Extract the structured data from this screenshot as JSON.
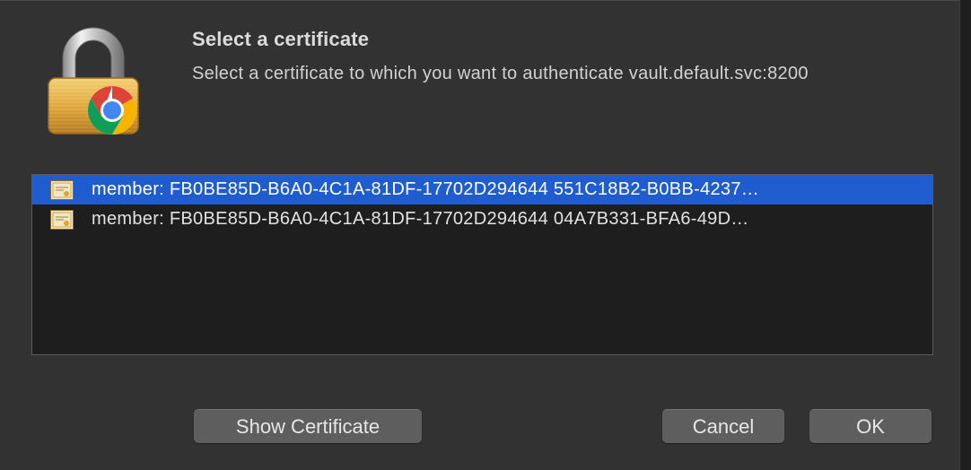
{
  "dialog": {
    "title": "Select a certificate",
    "message": "Select a certificate to which you want to authenticate vault.default.svc:8200",
    "app_icon": "lock-with-chrome-badge-icon"
  },
  "certificates": [
    {
      "label": "member: FB0BE85D-B6A0-4C1A-81DF-17702D294644 551C18B2-B0BB-4237…",
      "selected": true,
      "icon": "certificate-icon"
    },
    {
      "label": "member: FB0BE85D-B6A0-4C1A-81DF-17702D294644 04A7B331-BFA6-49D…",
      "selected": false,
      "icon": "certificate-icon"
    }
  ],
  "buttons": {
    "show_certificate": "Show Certificate",
    "cancel": "Cancel",
    "ok": "OK"
  },
  "colors": {
    "dialog_bg": "#323232",
    "list_bg": "#1e1e1e",
    "selection": "#1f5ccf",
    "button_bg": "#5e5e5e"
  }
}
